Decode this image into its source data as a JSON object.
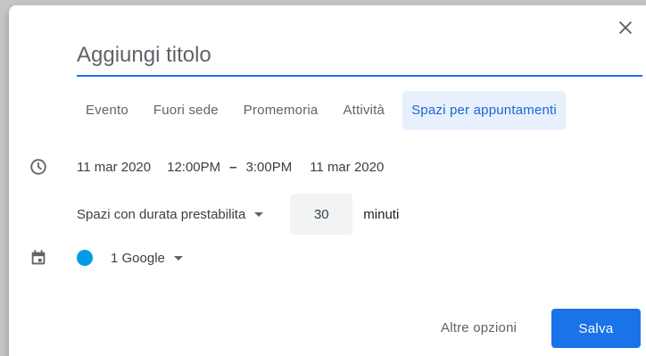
{
  "dialog": {
    "title_placeholder": "Aggiungi titolo",
    "close_icon": "close-icon"
  },
  "tabs": [
    {
      "label": "Evento",
      "active": false
    },
    {
      "label": "Fuori sede",
      "active": false
    },
    {
      "label": "Promemoria",
      "active": false
    },
    {
      "label": "Attività",
      "active": false
    },
    {
      "label": "Spazi per appuntamenti",
      "active": true
    }
  ],
  "datetime": {
    "icon": "clock-icon",
    "start_date": "11 mar 2020",
    "start_time": "12:00PM",
    "separator": "–",
    "end_time": "3:00PM",
    "end_date": "11 mar 2020"
  },
  "slots": {
    "mode": "Spazi con durata prestabilita",
    "duration": "30",
    "unit": "minuti"
  },
  "calendar": {
    "icon": "calendar-icon",
    "name": "1 Google",
    "color": "#039be5"
  },
  "footer": {
    "more_options": "Altre opzioni",
    "save": "Salva"
  },
  "colors": {
    "accent": "#1a73e8",
    "active_tab_bg": "#e8f0fe",
    "active_tab_text": "#1967d2"
  }
}
